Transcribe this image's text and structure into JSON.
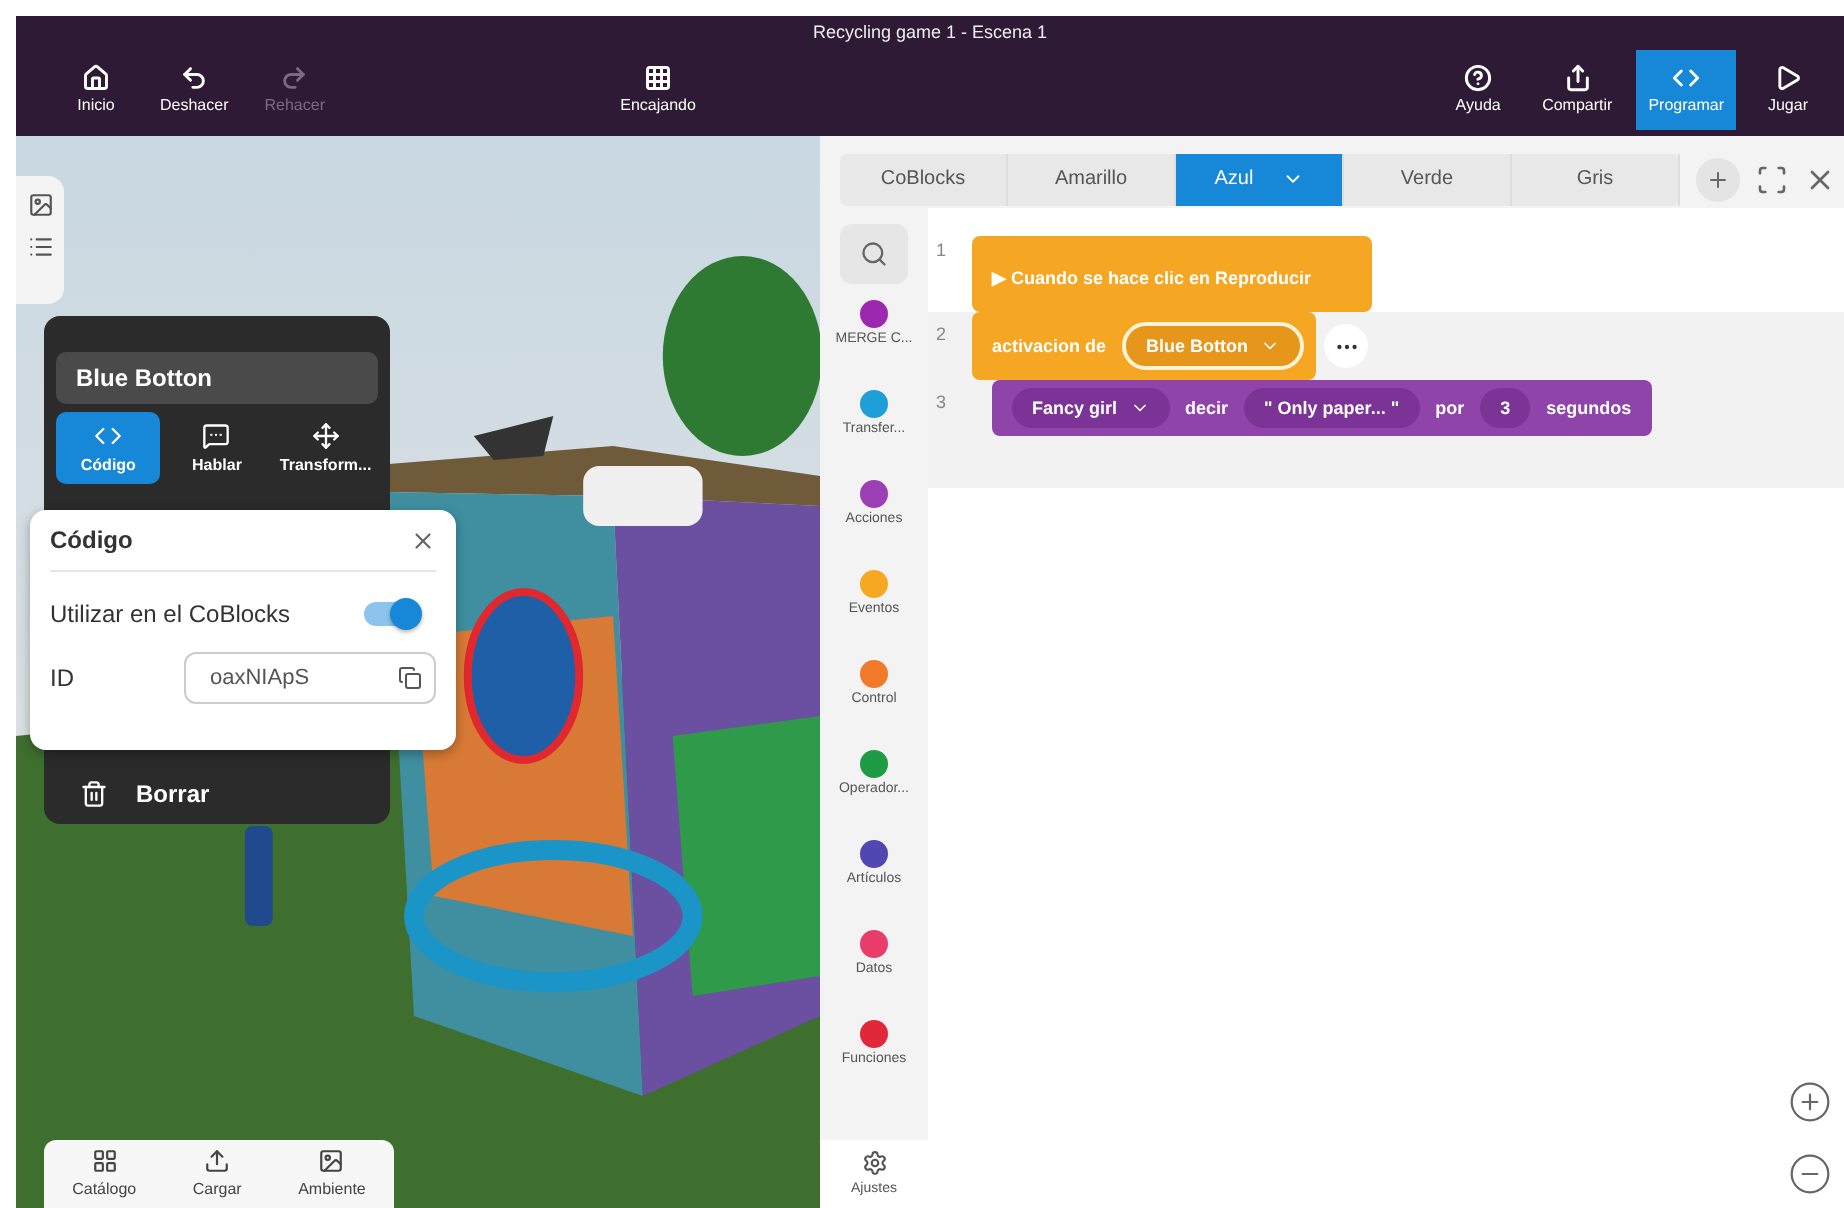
{
  "window": {
    "title": "Recycling game 1 - Escena 1"
  },
  "toolbar": {
    "left": [
      {
        "label": "Inicio",
        "disabled": false
      },
      {
        "label": "Deshacer",
        "disabled": false
      },
      {
        "label": "Rehacer",
        "disabled": true
      }
    ],
    "center": [
      {
        "label": "Encajando",
        "disabled": false
      }
    ],
    "right": [
      {
        "label": "Ayuda",
        "selected": false
      },
      {
        "label": "Compartir",
        "selected": false
      },
      {
        "label": "Programar",
        "selected": true
      },
      {
        "label": "Jugar",
        "selected": false
      }
    ]
  },
  "object_panel": {
    "name": "Blue Botton",
    "tabs": [
      {
        "label": "Código",
        "selected": true
      },
      {
        "label": "Hablar",
        "selected": false
      },
      {
        "label": "Transform...",
        "selected": false
      }
    ],
    "delete": "Borrar"
  },
  "code_popup": {
    "title": "Código",
    "toggle": {
      "label": "Utilizar en el CoBlocks",
      "on": true
    },
    "id_label": "ID",
    "id_value": "oaxNIApS"
  },
  "bottom_bar": [
    {
      "label": "Catálogo"
    },
    {
      "label": "Cargar"
    },
    {
      "label": "Ambiente"
    }
  ],
  "editor_tabs": [
    {
      "label": "CoBlocks",
      "selected": false
    },
    {
      "label": "Amarillo",
      "selected": false
    },
    {
      "label": "Azul",
      "selected": true
    },
    {
      "label": "Verde",
      "selected": false
    },
    {
      "label": "Gris",
      "selected": false
    }
  ],
  "categories": [
    {
      "label": "MERGE C...",
      "color": "#9c27b0"
    },
    {
      "label": "Transfer...",
      "color": "#1e9fd8"
    },
    {
      "label": "Acciones",
      "color": "#9c3fb5"
    },
    {
      "label": "Eventos",
      "color": "#f7a823"
    },
    {
      "label": "Control",
      "color": "#f07a2a"
    },
    {
      "label": "Operador...",
      "color": "#1f9a45"
    },
    {
      "label": "Artículos",
      "color": "#5147b3"
    },
    {
      "label": "Datos",
      "color": "#e93c6a"
    },
    {
      "label": "Funciones",
      "color": "#e0283a"
    }
  ],
  "settings": {
    "label": "Ajustes"
  },
  "code": {
    "line_numbers": [
      "1",
      "2",
      "3"
    ],
    "event": "▶ Cuando se hace clic en Reproducir",
    "activation": {
      "label": "activacion de",
      "object": "Blue Botton"
    },
    "say": {
      "actor": "Fancy girl",
      "verb": "decir",
      "text": "\"  Only paper...  \"",
      "for": "por",
      "seconds": "3",
      "unit": "segundos"
    }
  }
}
